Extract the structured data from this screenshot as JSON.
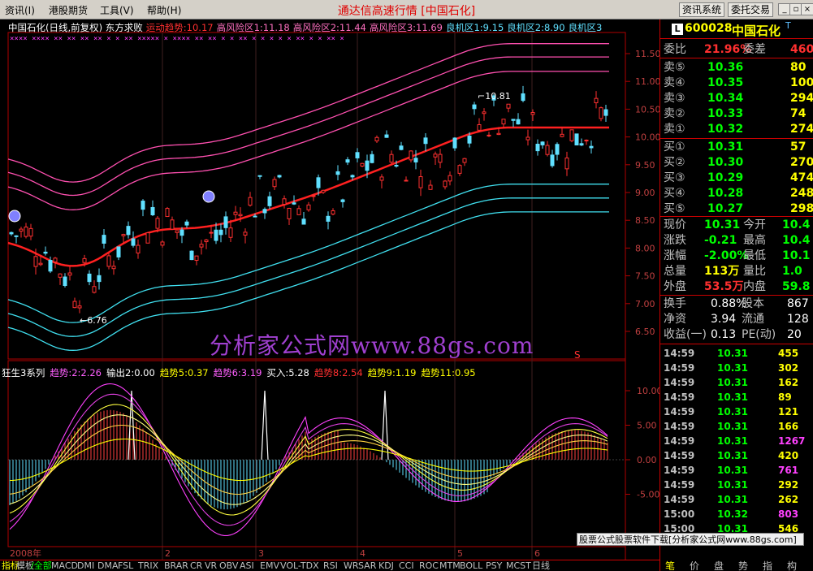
{
  "menu": [
    {
      "label": "资讯(I)",
      "key": "info"
    },
    {
      "label": "港股期货",
      "key": "hk"
    },
    {
      "label": "工具(V)",
      "key": "tools"
    },
    {
      "label": "帮助(H)",
      "key": "help"
    }
  ],
  "app_title": "通达信高速行情 [中国石化]",
  "top_buttons": {
    "info_system": "资讯系统",
    "order_trade": "委托交易"
  },
  "window_controls": {
    "minimize": "_",
    "restore": "▫",
    "close": "×"
  },
  "main_chart": {
    "legend": [
      {
        "text": "中国石化(日线,前复权) 东方求败",
        "color": "#ffffff"
      },
      {
        "text": "运动趋势:10.17",
        "color": "#ff3030"
      },
      {
        "text": "高风险区1:11.18",
        "color": "#ff70c0"
      },
      {
        "text": "高风险区2:11.44",
        "color": "#ff70c0"
      },
      {
        "text": "高风险区3:11.69",
        "color": "#ff70c0"
      },
      {
        "text": "良机区1:9.15",
        "color": "#60e0ff"
      },
      {
        "text": "良机区2:8.90",
        "color": "#60e0ff"
      },
      {
        "text": "良机区3",
        "color": "#60e0ff"
      }
    ],
    "y_ticks": [
      "11.50",
      "11.00",
      "10.50",
      "10.00",
      "9.50",
      "9.00",
      "8.50",
      "8.00",
      "7.50",
      "7.00",
      "6.50"
    ],
    "high_label": "10.81",
    "low_label": "6.76",
    "s_marker": "S"
  },
  "indicator": {
    "legend": [
      {
        "text": "狂生3系列",
        "color": "#ffffff"
      },
      {
        "text": "趋势:2:2.26",
        "color": "#ff60ff"
      },
      {
        "text": "输出2:0.00",
        "color": "#ffffff"
      },
      {
        "text": "趋势5:0.37",
        "color": "#ffff00"
      },
      {
        "text": "趋势6:3.19",
        "color": "#ff60ff"
      },
      {
        "text": "买入:5.28",
        "color": "#ffffff"
      },
      {
        "text": "趋势8:2.54",
        "color": "#ff3030"
      },
      {
        "text": "趋势9:1.19",
        "color": "#ffff00"
      },
      {
        "text": "趋势11:0.95",
        "color": "#ffff00"
      }
    ],
    "y_ticks": [
      "10.00",
      "5.00",
      "0.00",
      "-5.00"
    ]
  },
  "x_axis": {
    "year": "2008年",
    "months": [
      "2",
      "3",
      "4",
      "5",
      "6"
    ]
  },
  "bottom_tabs": [
    "指标",
    "模板",
    "/全部",
    "MACD",
    "DMI",
    "DMA",
    "FSL",
    "TRIX",
    "BRAR",
    "CR",
    "VR",
    "OBV",
    "ASI",
    "EMV",
    "VOL-TDX",
    "RSI",
    "WR",
    "SAR",
    "KDJ",
    "CCI",
    "ROC",
    "MTM",
    "BOLL",
    "PSY",
    "MCST",
    "日线"
  ],
  "quote": {
    "code": "600028",
    "name": "中国石化",
    "weibi_label": "委比",
    "weibi": "21.96%",
    "weicha_label": "委差",
    "weicha": "460",
    "asks": [
      {
        "label": "卖⑤",
        "price": "10.36",
        "vol": "80"
      },
      {
        "label": "卖④",
        "price": "10.35",
        "vol": "100"
      },
      {
        "label": "卖③",
        "price": "10.34",
        "vol": "294"
      },
      {
        "label": "卖②",
        "price": "10.33",
        "vol": "74"
      },
      {
        "label": "卖①",
        "price": "10.32",
        "vol": "274"
      }
    ],
    "bids": [
      {
        "label": "买①",
        "price": "10.31",
        "vol": "57"
      },
      {
        "label": "买②",
        "price": "10.30",
        "vol": "270"
      },
      {
        "label": "买③",
        "price": "10.29",
        "vol": "474"
      },
      {
        "label": "买④",
        "price": "10.28",
        "vol": "248"
      },
      {
        "label": "买⑤",
        "price": "10.27",
        "vol": "298"
      }
    ],
    "stats": [
      {
        "l1": "现价",
        "v1": "10.31",
        "c1": "#00ff00",
        "l2": "今开",
        "v2": "10.4"
      },
      {
        "l1": "涨跌",
        "v1": "-0.21",
        "c1": "#00ff00",
        "l2": "最高",
        "v2": "10.4"
      },
      {
        "l1": "涨幅",
        "v1": "-2.00%",
        "c1": "#00ff00",
        "l2": "最低",
        "v2": "10.1"
      },
      {
        "l1": "总量",
        "v1": "113万",
        "c1": "#ffff00",
        "l2": "量比",
        "v2": "1.0"
      },
      {
        "l1": "外盘",
        "v1": "53.5万",
        "c1": "#ff3030",
        "l2": "内盘",
        "v2": "59.8"
      }
    ],
    "stats2": [
      {
        "l1": "换手",
        "v1": "0.88%",
        "l2": "股本",
        "v2": "867"
      },
      {
        "l1": "净资",
        "v1": "3.94",
        "l2": "流通",
        "v2": "128"
      },
      {
        "l1": "收益(一)",
        "v1": "0.13",
        "l2": "PE(动)",
        "v2": "20"
      }
    ],
    "ticks": [
      {
        "t": "14:59",
        "p": "10.31",
        "v": "455",
        "vc": "#ffff00"
      },
      {
        "t": "14:59",
        "p": "10.31",
        "v": "302",
        "vc": "#ffff00"
      },
      {
        "t": "14:59",
        "p": "10.31",
        "v": "162",
        "vc": "#ffff00"
      },
      {
        "t": "14:59",
        "p": "10.31",
        "v": "89",
        "vc": "#ffff00"
      },
      {
        "t": "14:59",
        "p": "10.31",
        "v": "121",
        "vc": "#ffff00"
      },
      {
        "t": "14:59",
        "p": "10.31",
        "v": "166",
        "vc": "#ffff00"
      },
      {
        "t": "14:59",
        "p": "10.31",
        "v": "1267",
        "vc": "#ff40ff"
      },
      {
        "t": "14:59",
        "p": "10.31",
        "v": "420",
        "vc": "#ffff00"
      },
      {
        "t": "14:59",
        "p": "10.31",
        "v": "761",
        "vc": "#ff40ff"
      },
      {
        "t": "14:59",
        "p": "10.31",
        "v": "292",
        "vc": "#ffff00"
      },
      {
        "t": "14:59",
        "p": "10.31",
        "v": "262",
        "vc": "#ffff00"
      },
      {
        "t": "15:00",
        "p": "10.32",
        "v": "803",
        "vc": "#ff40ff"
      },
      {
        "t": "15:00",
        "p": "10.31",
        "v": "546",
        "vc": "#ffff00"
      }
    ],
    "panel_tabs": [
      "笔",
      "价",
      "盘",
      "势",
      "指",
      "构"
    ]
  },
  "watermark": "分析家公式网www.88gs.com",
  "footer_banner": "股票公式股票软件下载[分析家公式网www.88gs.com]",
  "colors": {
    "up": "#ff3030",
    "down": "#60e0ff",
    "trend": "#ff2020",
    "risk": "#ff3090",
    "chance": "#40e0f0"
  }
}
